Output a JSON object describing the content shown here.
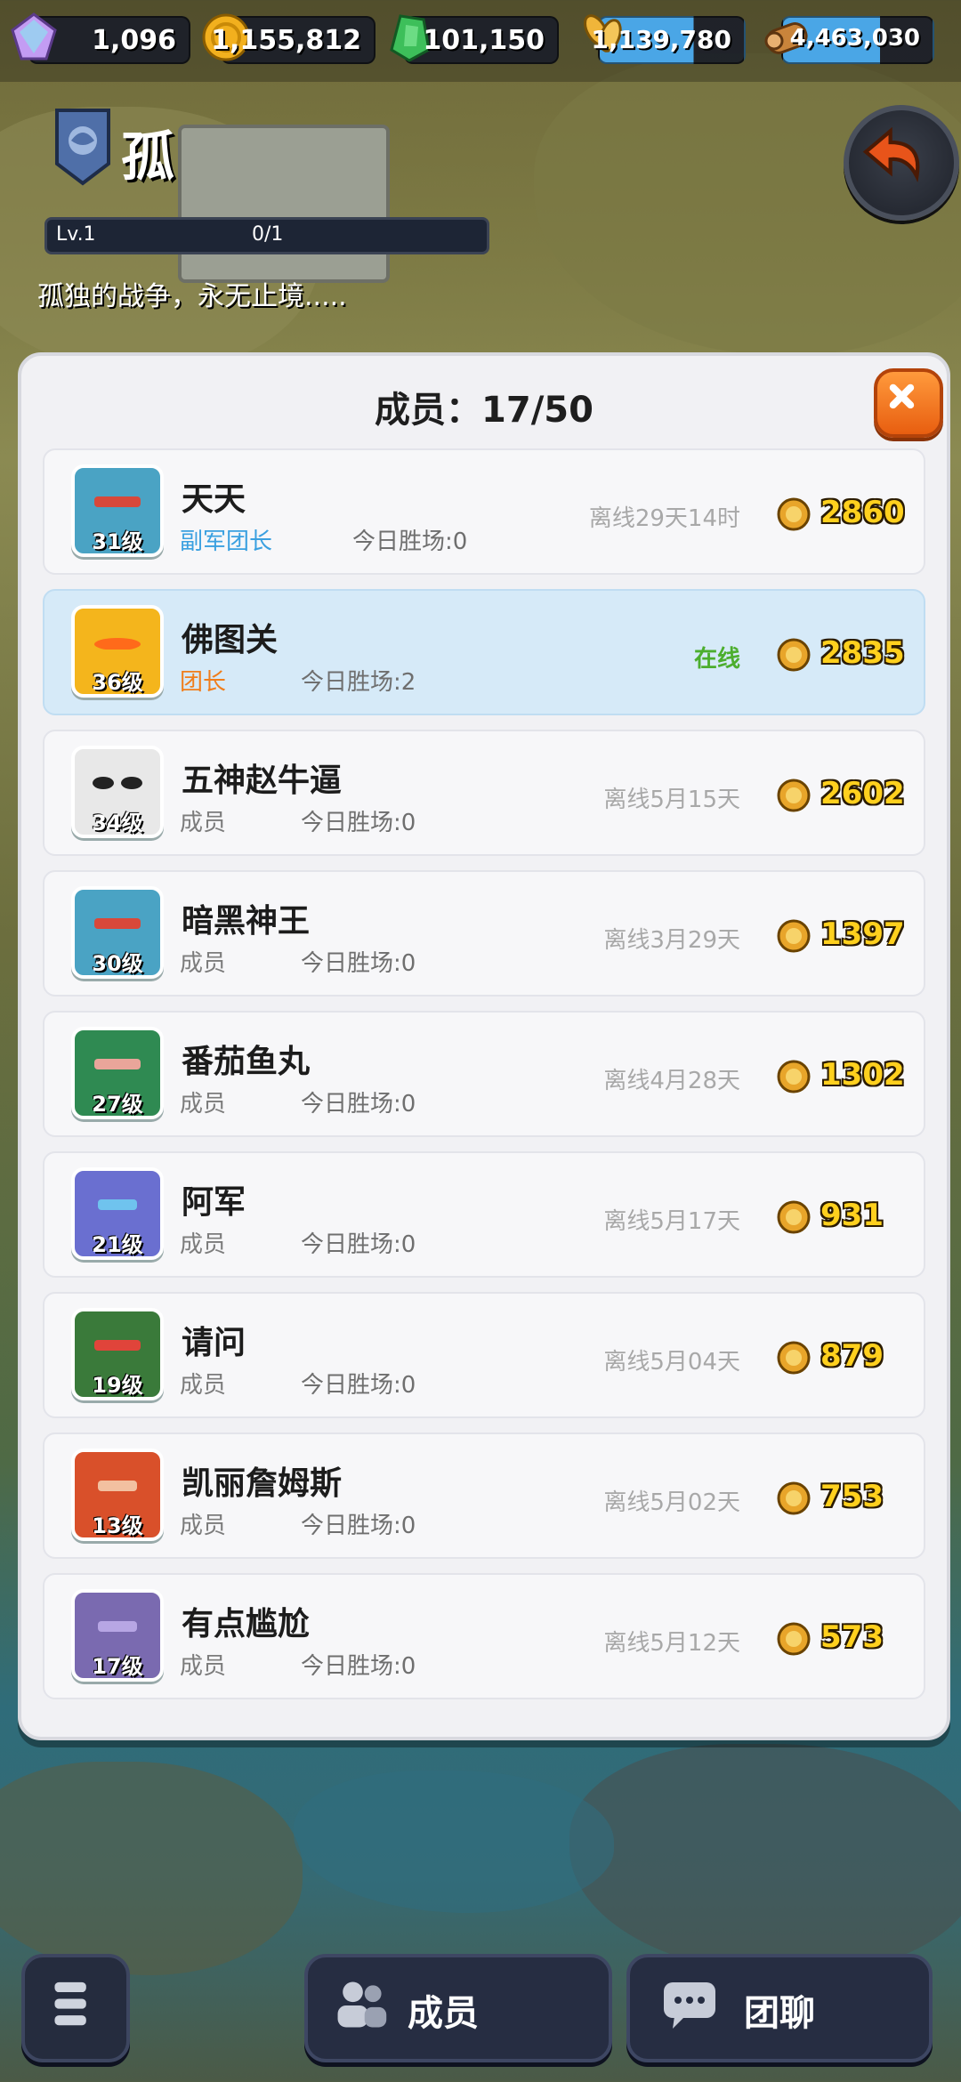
{
  "resources": [
    {
      "name": "gem",
      "value": "1,096",
      "color": "#b97fe8"
    },
    {
      "name": "coin",
      "value": "1,155,812",
      "color": "#f2b01e"
    },
    {
      "name": "jade",
      "value": "101,150",
      "color": "#3dbf5a"
    },
    {
      "name": "grain",
      "value": "1,139,780",
      "color": "#f0b53a"
    },
    {
      "name": "wood",
      "value": "4,463,030",
      "color": "#c9843b"
    }
  ],
  "guild": {
    "name": "孤",
    "level": "Lv.1",
    "xp": "0/1",
    "motto": "孤独的战争，永无止境....."
  },
  "panel": {
    "title": "成员：17/50"
  },
  "members": [
    {
      "name": "天天",
      "level": "31级",
      "role": "副军团长",
      "wins": "今日胜场:0",
      "status": "离线29天14时",
      "score": "2860",
      "avatar_color": "#4aa3c4"
    },
    {
      "name": "佛图关",
      "level": "36级",
      "role": "团长",
      "wins": "今日胜场:2",
      "status": "在线",
      "score": "2835",
      "avatar_color": "#f4b51c"
    },
    {
      "name": "五神赵牛逼",
      "level": "34级",
      "role": "成员",
      "wins": "今日胜场:0",
      "status": "离线5月15天",
      "score": "2602",
      "avatar_color": "#e8e8e8"
    },
    {
      "name": "暗黑神王",
      "level": "30级",
      "role": "成员",
      "wins": "今日胜场:0",
      "status": "离线3月29天",
      "score": "1397",
      "avatar_color": "#4aa3c4"
    },
    {
      "name": "番茄鱼丸",
      "level": "27级",
      "role": "成员",
      "wins": "今日胜场:0",
      "status": "离线4月28天",
      "score": "1302",
      "avatar_color": "#2f8a52"
    },
    {
      "name": "阿军",
      "level": "21级",
      "role": "成员",
      "wins": "今日胜场:0",
      "status": "离线5月17天",
      "score": "931",
      "avatar_color": "#6a6fd0"
    },
    {
      "name": "请问",
      "level": "19级",
      "role": "成员",
      "wins": "今日胜场:0",
      "status": "离线5月04天",
      "score": "879",
      "avatar_color": "#3a7a3a"
    },
    {
      "name": "凯丽詹姆斯",
      "level": "13级",
      "role": "成员",
      "wins": "今日胜场:0",
      "status": "离线5月02天",
      "score": "753",
      "avatar_color": "#d9502a"
    },
    {
      "name": "有点尴尬",
      "level": "17级",
      "role": "成员",
      "wins": "今日胜场:0",
      "status": "离线5月12天",
      "score": "573",
      "avatar_color": "#7a6ab0"
    }
  ],
  "bottom": {
    "members_label": "成员",
    "chat_label": "团聊"
  }
}
